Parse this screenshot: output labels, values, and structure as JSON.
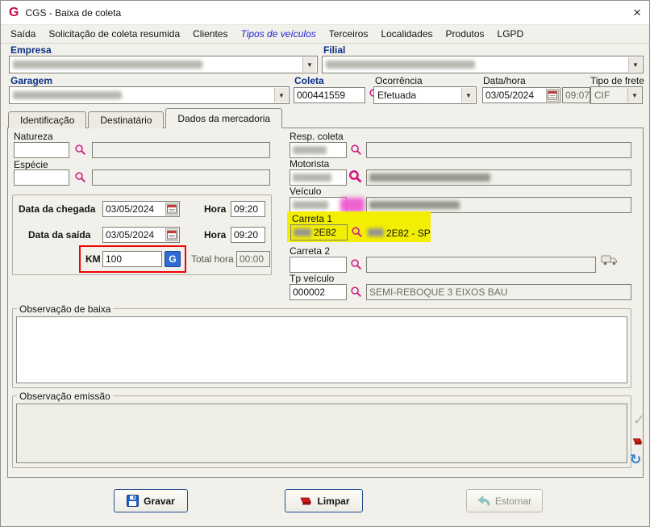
{
  "window": {
    "logo_letter": "G",
    "title": "CGS - Baixa de coleta",
    "close_glyph": "×"
  },
  "menu": {
    "items": [
      {
        "label": "Saída"
      },
      {
        "label": "Solicitação de coleta resumida"
      },
      {
        "label": "Clientes"
      },
      {
        "label": "Tipos de veículos"
      },
      {
        "label": "Terceiros"
      },
      {
        "label": "Localidades"
      },
      {
        "label": "Produtos"
      },
      {
        "label": "LGPD"
      }
    ],
    "active_item": "Tipos de veículos"
  },
  "header": {
    "empresa_label": "Empresa",
    "filial_label": "Filial",
    "garagem_label": "Garagem",
    "coleta_label": "Coleta",
    "coleta_value": "000441559",
    "ocorrencia_label": "Ocorrência",
    "ocorrencia_value": "Efetuada",
    "datahora_label": "Data/hora",
    "data_value": "03/05/2024",
    "hora_value": "09:07",
    "tipo_frete_label": "Tipo de frete",
    "tipo_frete_value": "CIF"
  },
  "tabs": {
    "items": [
      {
        "label": "Identificação"
      },
      {
        "label": "Destinatário"
      },
      {
        "label": "Dados da mercadoria"
      }
    ],
    "active": "Dados da mercadoria"
  },
  "mercadoria": {
    "natureza_label": "Natureza",
    "especie_label": "Espécie",
    "data_chegada_label": "Data da chegada",
    "data_chegada_value": "03/05/2024",
    "hora_chegada_label": "Hora",
    "hora_chegada_value": "09:20",
    "data_saida_label": "Data da saída",
    "data_saida_value": "03/05/2024",
    "hora_saida_label": "Hora",
    "hora_saida_value": "09:20",
    "km_label": "KM",
    "km_value": "100",
    "km_button_letter": "G",
    "total_hora_label": "Total hora",
    "total_hora_value": "00:00",
    "resp_coleta_label": "Resp. coleta",
    "motorista_label": "Motorista",
    "veiculo_label": "Veículo",
    "carreta1_label": "Carreta 1",
    "carreta1_code_visible": "2E82",
    "carreta1_desc_visible": "2E82 - SP",
    "carreta2_label": "Carreta 2",
    "tp_veiculo_label": "Tp veículo",
    "tp_veiculo_code": "000002",
    "tp_veiculo_desc": "SEMI-REBOQUE 3 EIXOS BAU",
    "obs_baixa_label": "Observação de baixa",
    "obs_emissao_label": "Observação emissão"
  },
  "footer": {
    "gravar_label": "Gravar",
    "limpar_label": "Limpar",
    "estornar_label": "Estornar"
  },
  "colors": {
    "navy_label": "#0b2f86",
    "magenta_icon": "#d2147e",
    "yellow_highlight": "#f2ee04",
    "red_highlight": "#ec0404",
    "menu_active": "#2424d8",
    "km_button_blue": "#2e6cd4"
  }
}
